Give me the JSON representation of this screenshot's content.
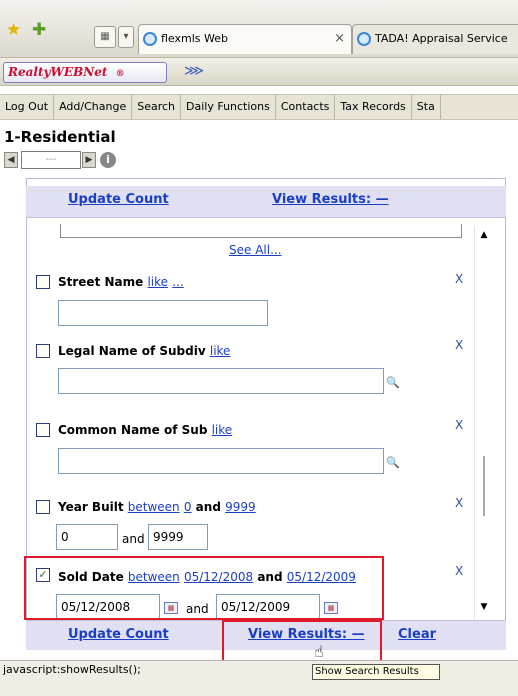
{
  "tabs": [
    {
      "label": "flexmls Web"
    },
    {
      "label": "TADA! Appraisal Service"
    }
  ],
  "tab_close_glyph": "×",
  "app": {
    "logo_text": "RealtyWEBNet",
    "logo_mark": "®"
  },
  "nav": [
    "Log Out",
    "Add/Change",
    "Search",
    "Daily Functions",
    "Contacts",
    "Tax Records",
    "Sta"
  ],
  "page_title": "1-Residential",
  "pager": {
    "value": "---"
  },
  "actions": {
    "update_count": "Update Count",
    "view_results": "View Results: —",
    "clear": "Clear"
  },
  "see_all": "See All...",
  "fields": [
    {
      "label": "Street Name",
      "op": "like",
      "op2": "...",
      "value": ""
    },
    {
      "label": "Legal Name of Subdiv",
      "op": "like",
      "value": ""
    },
    {
      "label": "Common Name of Sub",
      "op": "like",
      "value": ""
    },
    {
      "label": "Year Built",
      "op": "between",
      "from": "0",
      "and": "and",
      "to": "9999",
      "value_from": "0",
      "value_to": "9999"
    },
    {
      "label": "Sold Date",
      "op": "between",
      "from": "05/12/2008",
      "and": "and",
      "to": "05/12/2009",
      "value_from": "05/12/2008",
      "value_to": "05/12/2009",
      "checked": true
    }
  ],
  "remove_glyph": "X",
  "status_text": "javascript:showResults();",
  "tooltip": "Show Search Results",
  "colors": {
    "highlight": "#e01a2a",
    "link": "#1a3fc4"
  }
}
